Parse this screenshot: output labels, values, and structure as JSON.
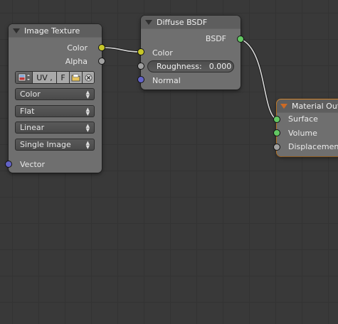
{
  "colors": {
    "canvas": "#393939",
    "node_body": "#6f6f6f",
    "node_header": "#5e5e5e",
    "socket_color": "#c7c729",
    "socket_float": "#a1a1a1",
    "socket_vector": "#6363c7",
    "socket_shader": "#63c763",
    "output_node_border": "#e8932f",
    "output_header_accent": "#cc6a24"
  },
  "image_texture": {
    "title": "Image Texture",
    "outputs": [
      "Color",
      "Alpha"
    ],
    "image_bar": {
      "browse_icon": "image-browse-icon",
      "name": "UV ,",
      "fake_user": "F",
      "open_icon": "folder-open-icon",
      "unlink_icon": "close-icon"
    },
    "color_space": "Color",
    "projection": "Flat",
    "interpolation": "Linear",
    "source": "Single Image",
    "input_vector": "Vector"
  },
  "diffuse": {
    "title": "Diffuse BSDF",
    "output": "BSDF",
    "input_color": "Color",
    "roughness_label": "Roughness:",
    "roughness_value": "0.000",
    "input_normal": "Normal"
  },
  "output_node": {
    "title": "Material Output",
    "surface": "Surface",
    "volume": "Volume",
    "displacement": "Displacement"
  }
}
